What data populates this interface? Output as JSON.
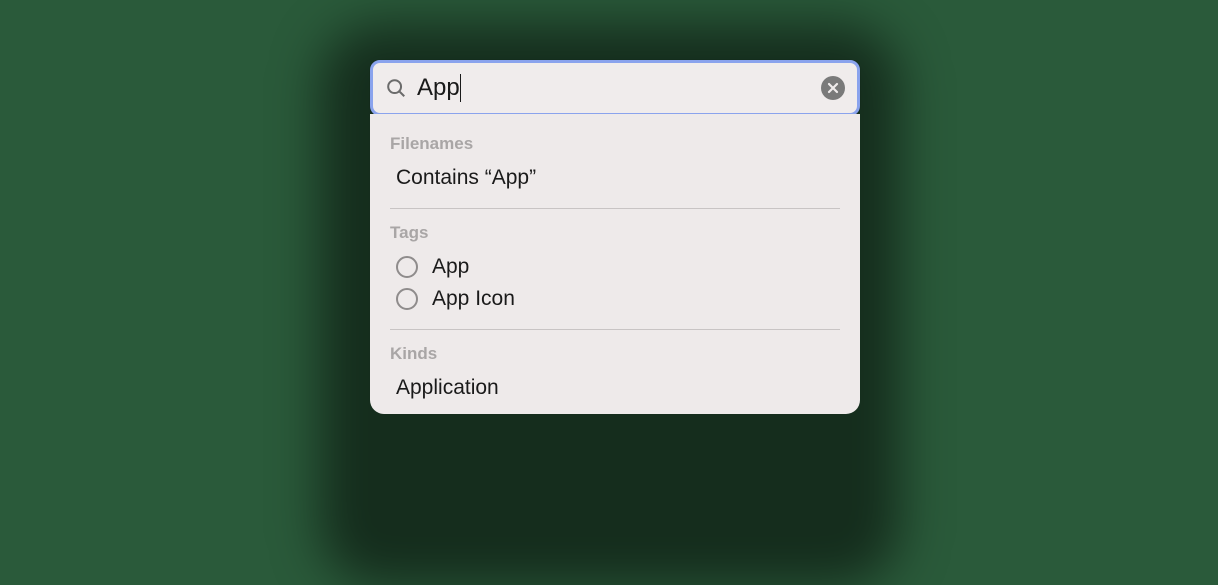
{
  "search": {
    "value": "App",
    "placeholder": ""
  },
  "sections": {
    "filenames": {
      "header": "Filenames",
      "items": [
        "Contains “App”"
      ]
    },
    "tags": {
      "header": "Tags",
      "items": [
        "App",
        "App Icon"
      ]
    },
    "kinds": {
      "header": "Kinds",
      "items": [
        "Application"
      ]
    }
  },
  "icons": {
    "search": "search-icon",
    "clear": "clear-icon",
    "tag": "tag-circle-icon"
  }
}
